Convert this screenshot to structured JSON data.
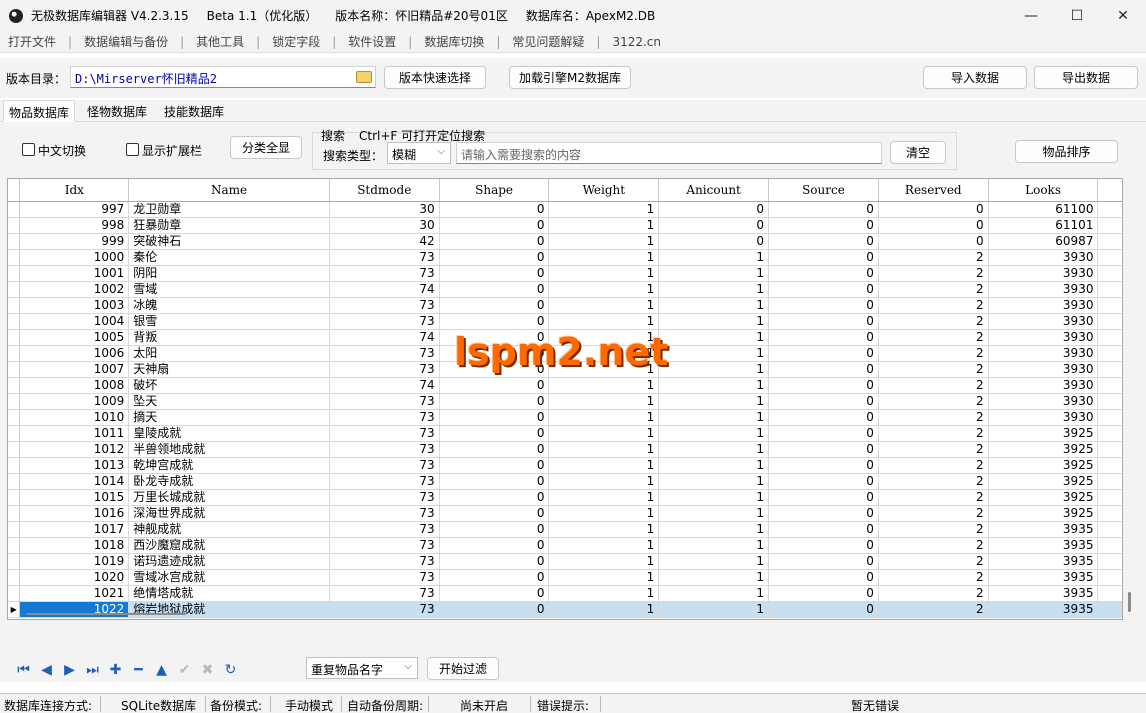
{
  "window": {
    "app_title": "无极数据库编辑器 V4.2.3.15",
    "beta": "Beta 1.1（优化版）",
    "version_name": "版本名称：怀旧精品#20号01区",
    "db_name": "数据库名：ApexM2.DB",
    "minimize": "—",
    "maximize": "☐",
    "close": "✕"
  },
  "menu": [
    "打开文件",
    "数据编辑与备份",
    "其他工具",
    "锁定字段",
    "软件设置",
    "数据库切换",
    "常见问题解疑",
    "3122.cn"
  ],
  "dirrow": {
    "label": "版本目录：",
    "path": "D:\\Mirserver怀旧精品2",
    "quick_select": "版本快速选择",
    "load_engine": "加载引擎M2数据库",
    "import": "导入数据",
    "export": "导出数据"
  },
  "tabs": [
    "物品数据库",
    "怪物数据库",
    "技能数据库"
  ],
  "filters": {
    "chinese_switch": "中文切换",
    "show_ext": "显示扩展栏",
    "category_all": "分类全显",
    "search_title": "搜索",
    "search_hint": "Ctrl+F 可打开定位搜索",
    "search_type_label": "搜索类型：",
    "search_type_value": "模糊",
    "search_placeholder": "请输入需要搜索的内容",
    "clear": "清空",
    "sort": "物品排序"
  },
  "grid": {
    "columns": [
      "Idx",
      "Name",
      "Stdmode",
      "Shape",
      "Weight",
      "Anicount",
      "Source",
      "Reserved",
      "Looks"
    ],
    "rows": [
      [
        "997",
        "龙卫勋章",
        "30",
        "0",
        "1",
        "0",
        "0",
        "0",
        "61100"
      ],
      [
        "998",
        "狂暴勋章",
        "30",
        "0",
        "1",
        "0",
        "0",
        "0",
        "61101"
      ],
      [
        "999",
        "突破神石",
        "42",
        "0",
        "1",
        "0",
        "0",
        "0",
        "60987"
      ],
      [
        "1000",
        "秦伦",
        "73",
        "0",
        "1",
        "1",
        "0",
        "2",
        "3930"
      ],
      [
        "1001",
        "阴阳",
        "73",
        "0",
        "1",
        "1",
        "0",
        "2",
        "3930"
      ],
      [
        "1002",
        "雪域",
        "74",
        "0",
        "1",
        "1",
        "0",
        "2",
        "3930"
      ],
      [
        "1003",
        "冰魄",
        "73",
        "0",
        "1",
        "1",
        "0",
        "2",
        "3930"
      ],
      [
        "1004",
        "银雪",
        "73",
        "0",
        "1",
        "1",
        "0",
        "2",
        "3930"
      ],
      [
        "1005",
        "背叛",
        "74",
        "0",
        "1",
        "1",
        "0",
        "2",
        "3930"
      ],
      [
        "1006",
        "太阳",
        "73",
        "0",
        "1",
        "1",
        "0",
        "2",
        "3930"
      ],
      [
        "1007",
        "天神扇",
        "73",
        "0",
        "1",
        "1",
        "0",
        "2",
        "3930"
      ],
      [
        "1008",
        "破坏",
        "74",
        "0",
        "1",
        "1",
        "0",
        "2",
        "3930"
      ],
      [
        "1009",
        "坠天",
        "73",
        "0",
        "1",
        "1",
        "0",
        "2",
        "3930"
      ],
      [
        "1010",
        "摘天",
        "73",
        "0",
        "1",
        "1",
        "0",
        "2",
        "3930"
      ],
      [
        "1011",
        "皇陵成就",
        "73",
        "0",
        "1",
        "1",
        "0",
        "2",
        "3925"
      ],
      [
        "1012",
        "半兽领地成就",
        "73",
        "0",
        "1",
        "1",
        "0",
        "2",
        "3925"
      ],
      [
        "1013",
        "乾坤宫成就",
        "73",
        "0",
        "1",
        "1",
        "0",
        "2",
        "3925"
      ],
      [
        "1014",
        "卧龙寺成就",
        "73",
        "0",
        "1",
        "1",
        "0",
        "2",
        "3925"
      ],
      [
        "1015",
        "万里长城成就",
        "73",
        "0",
        "1",
        "1",
        "0",
        "2",
        "3925"
      ],
      [
        "1016",
        "深海世界成就",
        "73",
        "0",
        "1",
        "1",
        "0",
        "2",
        "3925"
      ],
      [
        "1017",
        "神舰成就",
        "73",
        "0",
        "1",
        "1",
        "0",
        "2",
        "3935"
      ],
      [
        "1018",
        "西沙魔窟成就",
        "73",
        "0",
        "1",
        "1",
        "0",
        "2",
        "3935"
      ],
      [
        "1019",
        "诺玛遗迹成就",
        "73",
        "0",
        "1",
        "1",
        "0",
        "2",
        "3935"
      ],
      [
        "1020",
        "雪域冰宫成就",
        "73",
        "0",
        "1",
        "1",
        "0",
        "2",
        "3935"
      ],
      [
        "1021",
        "绝情塔成就",
        "73",
        "0",
        "1",
        "1",
        "0",
        "2",
        "3935"
      ],
      [
        "1022",
        "熔岩地狱成就",
        "73",
        "0",
        "1",
        "1",
        "0",
        "2",
        "3935"
      ]
    ],
    "selected_index": 25
  },
  "watermark": "lspm2.net",
  "bottom": {
    "dup_filter": "重复物品名字",
    "start_filter": "开始过滤"
  },
  "status": {
    "conn_label": "数据库连接方式:",
    "conn_value": "SQLite数据库",
    "backup_label": "备份模式:",
    "backup_value": "手动模式",
    "auto_label": "自动备份周期:",
    "auto_value": "尚未开启",
    "err_label": "错误提示:",
    "err_value": "暂无错误"
  }
}
